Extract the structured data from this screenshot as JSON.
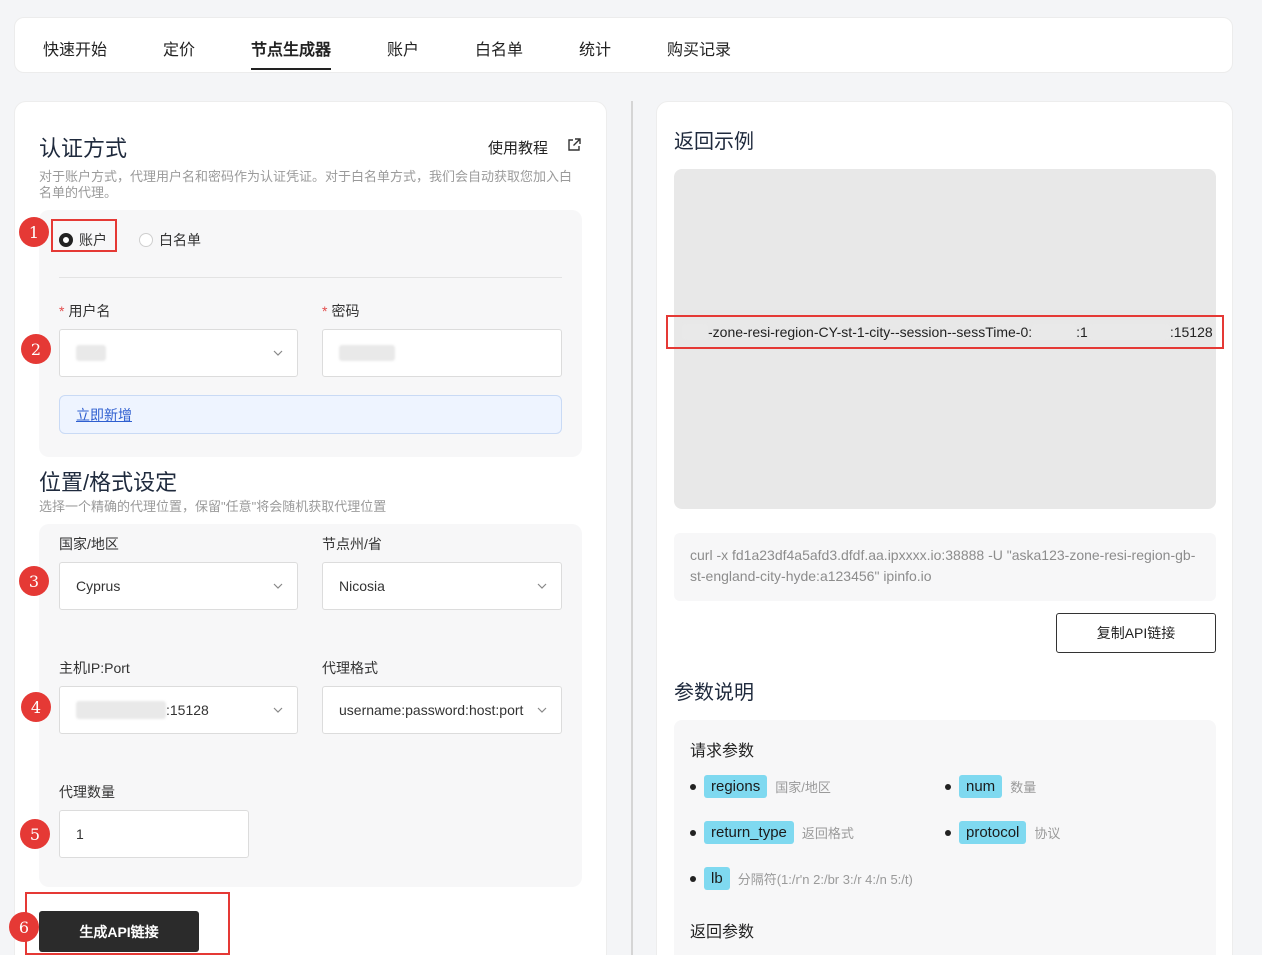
{
  "tabs": [
    {
      "label": "快速开始",
      "active": false
    },
    {
      "label": "定价",
      "active": false
    },
    {
      "label": "节点生成器",
      "active": true
    },
    {
      "label": "账户",
      "active": false
    },
    {
      "label": "白名单",
      "active": false
    },
    {
      "label": "统计",
      "active": false
    },
    {
      "label": "购买记录",
      "active": false
    }
  ],
  "auth": {
    "title": "认证方式",
    "tutorial_link": "使用教程",
    "description": "对于账户方式，代理用户名和密码作为认证凭证。对于白名单方式，我们会自动获取您加入白名单的代理。",
    "options": [
      {
        "label": "账户",
        "selected": true
      },
      {
        "label": "白名单",
        "selected": false
      }
    ],
    "username_label": "用户名",
    "password_label": "密码",
    "add_now": "立即新增"
  },
  "location": {
    "title": "位置/格式设定",
    "description": "选择一个精确的代理位置，保留\"任意\"将会随机获取代理位置",
    "country_label": "国家/地区",
    "country_value": "Cyprus",
    "state_label": "节点州/省",
    "state_value": "Nicosia",
    "host_label": "主机IP:Port",
    "host_port_suffix": ":15128",
    "format_label": "代理格式",
    "format_value": "username:password:host:port",
    "quantity_label": "代理数量",
    "quantity_value": "1"
  },
  "generate_button": "生成API链接",
  "steps": [
    "1",
    "2",
    "3",
    "4",
    "5",
    "6"
  ],
  "example": {
    "title": "返回示例",
    "line_mid": "-zone-resi-region-CY-st-1-city--session--sessTime-0:",
    "line_mid2": ":1",
    "line_end": ":15128",
    "curl": "curl -x fd1a23df4a5afd3.dfdf.aa.ipxxxx.io:38888 -U \"aska123-zone-resi-region-gb-st-england-city-hyde:a123456\" ipinfo.io",
    "copy_button": "复制API链接"
  },
  "params": {
    "title": "参数说明",
    "request_title": "请求参数",
    "items": [
      {
        "name": "regions",
        "desc": "国家/地区"
      },
      {
        "name": "num",
        "desc": "数量"
      },
      {
        "name": "return_type",
        "desc": "返回格式"
      },
      {
        "name": "protocol",
        "desc": "协议"
      },
      {
        "name": "lb",
        "desc": "分隔符(1:/r'n 2:/br 3:/r 4:/n 5:/t)"
      }
    ],
    "response_title": "返回参数"
  },
  "colors": {
    "accent_red": "#e53935",
    "tag_cyan": "#7fd9f0",
    "link_blue": "#2f5fd0",
    "button_dark": "#2b2b2b"
  }
}
